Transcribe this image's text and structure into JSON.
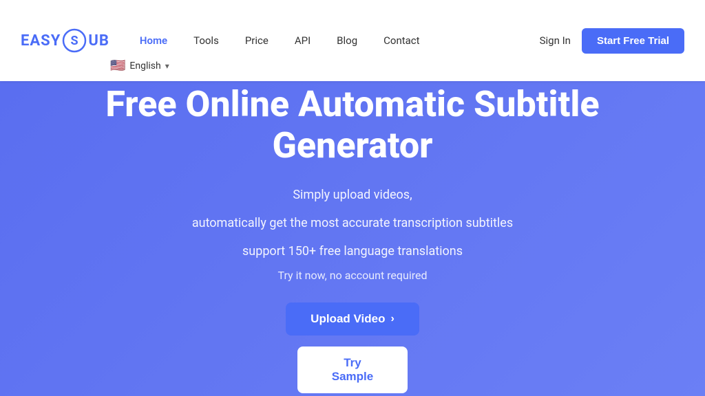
{
  "navbar": {
    "logo": "EASY SUB",
    "nav_items": [
      {
        "label": "Home",
        "active": true
      },
      {
        "label": "Tools",
        "active": false
      },
      {
        "label": "Price",
        "active": false
      },
      {
        "label": "API",
        "active": false
      },
      {
        "label": "Blog",
        "active": false
      },
      {
        "label": "Contact",
        "active": false
      }
    ],
    "sign_in": "Sign In",
    "start_trial": "Start Free Trial",
    "language": {
      "flag": "🇺🇸",
      "label": "English"
    }
  },
  "hero": {
    "title": "Free Online Automatic Subtitle Generator",
    "subtitle_line1": "Simply upload videos,",
    "subtitle_line2": "automatically get the most accurate transcription subtitles",
    "subtitle_line3": "support 150+ free language translations",
    "tagline": "Try it now, no account required",
    "upload_btn": "Upload Video",
    "try_sample_btn": "Try Sample",
    "arrow": "›"
  },
  "icons": {
    "chevron_down": "▾"
  }
}
